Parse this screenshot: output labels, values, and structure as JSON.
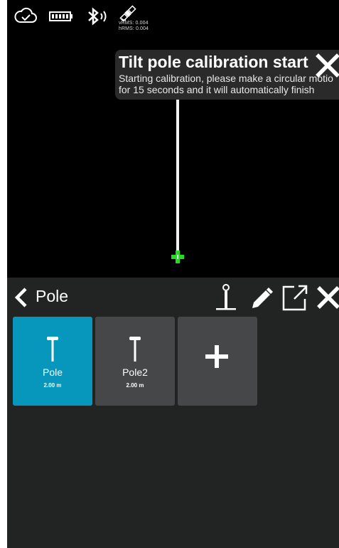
{
  "status_bar": {
    "icons": [
      "cloud-check-icon",
      "battery-icon",
      "bluetooth-icon",
      "satellite-icon"
    ],
    "vrms": "vRMS: 0.004",
    "hrms": "hRMS: 0.004"
  },
  "toast": {
    "title": "Tilt pole calibration start",
    "message_line1": "Starting calibration, please make a circular motio",
    "message_line2": "for 15 seconds and it will automatically finish"
  },
  "panel": {
    "title": "Pole",
    "toolbar_icons": [
      "pole-icon",
      "edit-icon",
      "export-icon",
      "close-icon"
    ],
    "poles": [
      {
        "name": "Pole",
        "height": "2.00 m",
        "selected": true
      },
      {
        "name": "Pole2",
        "height": "2.00 m",
        "selected": false
      }
    ]
  },
  "colors": {
    "selected_tile": "#0797bd",
    "tile": "#454748",
    "panel_bg": "#222424",
    "marker": "#22dd22"
  }
}
